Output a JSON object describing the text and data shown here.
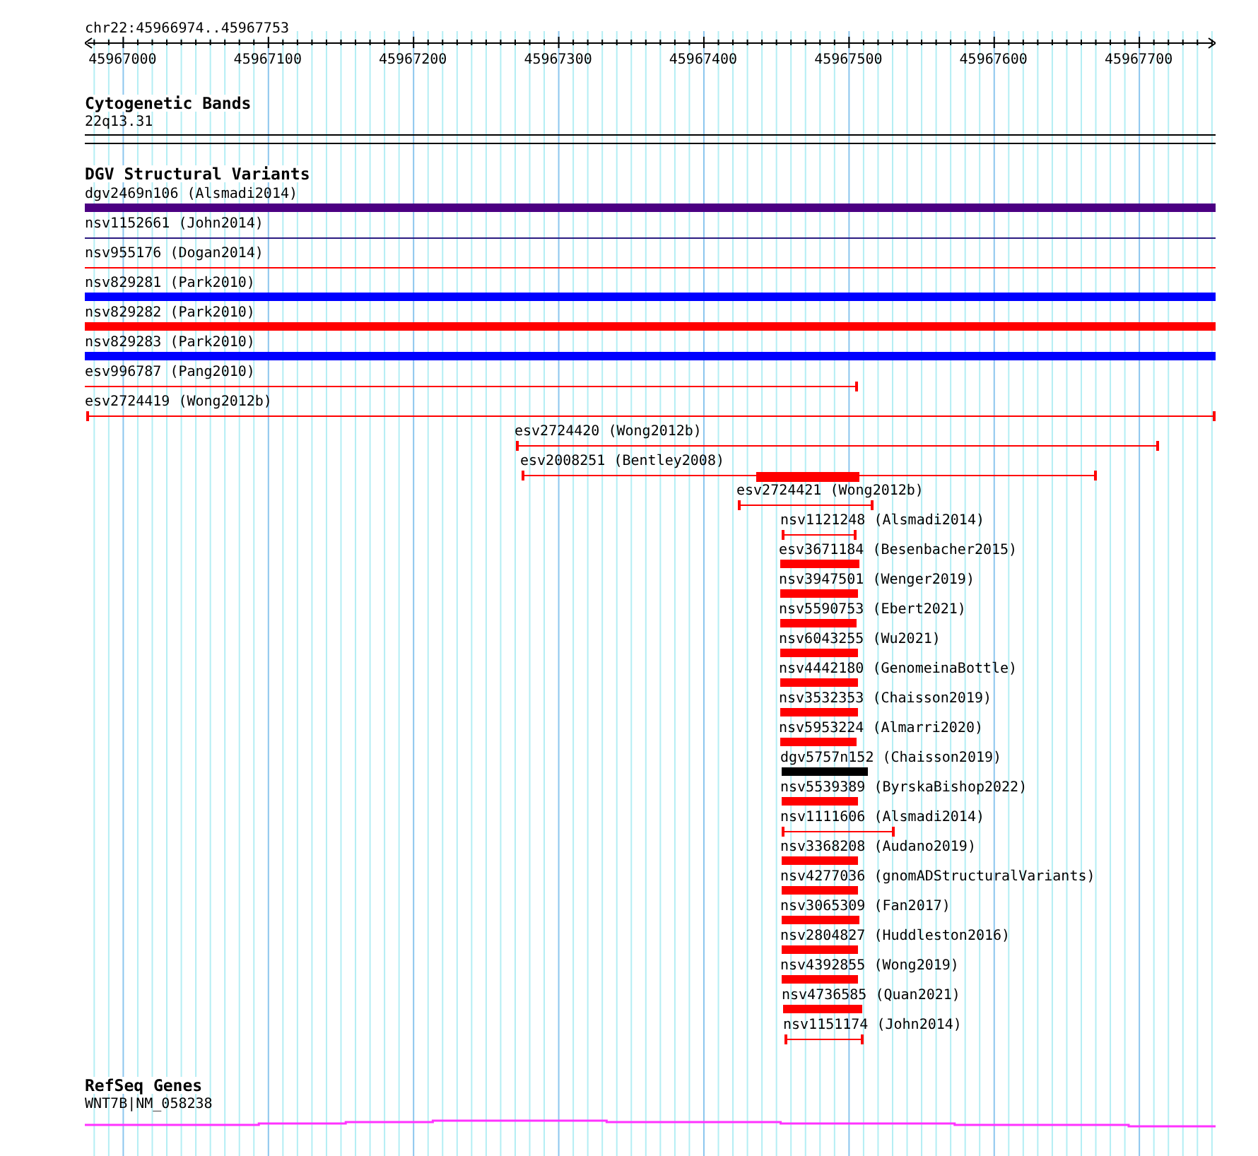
{
  "ruler": {
    "location": "chr22:45966974..45967753",
    "ticks": [
      "45967000",
      "45967100",
      "45967200",
      "45967300",
      "45967400",
      "45967500",
      "45967600",
      "45967700"
    ]
  },
  "tracks": [
    {
      "kind": "cytoband",
      "title": "Cytogenetic Bands",
      "label": "22q13.31"
    },
    {
      "kind": "variants",
      "title": "DGV Structural Variants",
      "features": [
        {
          "label": "dgv2469n106 (Alsmadi2014)",
          "kind": "bar",
          "color": "#4b0082"
        },
        {
          "label": "nsv1152661 (John2014)",
          "kind": "line",
          "color": "#2a1a80"
        },
        {
          "label": "nsv955176 (Dogan2014)",
          "kind": "line",
          "color": "#ff0000"
        },
        {
          "label": "nsv829281 (Park2010)",
          "kind": "bar",
          "color": "#0000ff"
        },
        {
          "label": "nsv829282 (Park2010)",
          "kind": "bar",
          "color": "#ff0000"
        },
        {
          "label": "nsv829283 (Park2010)",
          "kind": "bar",
          "color": "#0000ff"
        },
        {
          "label": "esv996787 (Pang2010)",
          "kind": "interval",
          "color": "#ff0000"
        },
        {
          "label": "esv2724419 (Wong2012b)",
          "kind": "interval",
          "color": "#ff0000"
        },
        {
          "label": "esv2724420 (Wong2012b)",
          "kind": "interval",
          "color": "#ff0000"
        },
        {
          "label": "esv2008251 (Bentley2008)",
          "kind": "interval_core",
          "color": "#ff0000"
        },
        {
          "label": "esv2724421 (Wong2012b)",
          "kind": "interval",
          "color": "#ff0000"
        },
        {
          "label": "nsv1121248 (Alsmadi2014)",
          "kind": "interval",
          "color": "#ff0000"
        },
        {
          "label": "esv3671184 (Besenbacher2015)",
          "kind": "bar",
          "color": "#ff0000"
        },
        {
          "label": "nsv3947501 (Wenger2019)",
          "kind": "bar",
          "color": "#ff0000"
        },
        {
          "label": "nsv5590753 (Ebert2021)",
          "kind": "bar",
          "color": "#ff0000"
        },
        {
          "label": "nsv6043255 (Wu2021)",
          "kind": "bar",
          "color": "#ff0000"
        },
        {
          "label": "nsv4442180 (GenomeinaBottle)",
          "kind": "bar",
          "color": "#ff0000"
        },
        {
          "label": "nsv3532353 (Chaisson2019)",
          "kind": "bar",
          "color": "#ff0000"
        },
        {
          "label": "nsv5953224 (Almarri2020)",
          "kind": "bar",
          "color": "#ff0000"
        },
        {
          "label": "dgv5757n152 (Chaisson2019)",
          "kind": "bar",
          "color": "#000000"
        },
        {
          "label": "nsv5539389 (ByrskaBishop2022)",
          "kind": "bar",
          "color": "#ff0000"
        },
        {
          "label": "nsv1111606 (Alsmadi2014)",
          "kind": "interval",
          "color": "#ff0000"
        },
        {
          "label": "nsv3368208 (Audano2019)",
          "kind": "bar",
          "color": "#ff0000"
        },
        {
          "label": "nsv4277036 (gnomADStructuralVariants)",
          "kind": "bar",
          "color": "#ff0000"
        },
        {
          "label": "nsv3065309 (Fan2017)",
          "kind": "bar",
          "color": "#ff0000"
        },
        {
          "label": "nsv2804827 (Huddleston2016)",
          "kind": "bar",
          "color": "#ff0000"
        },
        {
          "label": "nsv4392855 (Wong2019)",
          "kind": "bar",
          "color": "#ff0000"
        },
        {
          "label": "nsv4736585 (Quan2021)",
          "kind": "bar",
          "color": "#ff0000"
        },
        {
          "label": "nsv1151174 (John2014)",
          "kind": "interval",
          "color": "#ff0000"
        }
      ]
    },
    {
      "kind": "gene",
      "title": "RefSeq Genes",
      "label": "WNT7B|NM_058238"
    }
  ]
}
